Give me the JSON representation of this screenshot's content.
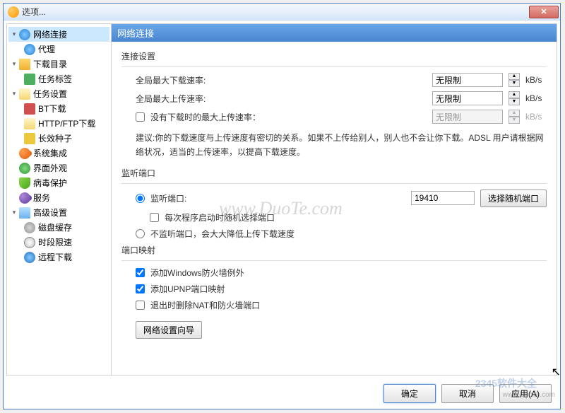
{
  "window": {
    "title": "选项..."
  },
  "sidebar": {
    "items": [
      {
        "label": "网络连接",
        "children": [
          {
            "label": "代理"
          }
        ]
      },
      {
        "label": "下载目录",
        "children": [
          {
            "label": "任务标签"
          }
        ]
      },
      {
        "label": "任务设置",
        "children": [
          {
            "label": "BT下载"
          },
          {
            "label": "HTTP/FTP下载"
          },
          {
            "label": "长效种子"
          }
        ]
      },
      {
        "label": "系统集成"
      },
      {
        "label": "界面外观"
      },
      {
        "label": "病毒保护"
      },
      {
        "label": "服务"
      },
      {
        "label": "高级设置",
        "children": [
          {
            "label": "磁盘缓存"
          },
          {
            "label": "时段限速"
          },
          {
            "label": "远程下载"
          }
        ]
      }
    ]
  },
  "content": {
    "header": "网络连接",
    "group_conn": "连接设置",
    "max_down_label": "全局最大下载速率:",
    "max_down_value": "无限制",
    "max_up_label": "全局最大上传速率:",
    "max_up_value": "无限制",
    "idle_upload_checkbox": "没有下载时的最大上传速率：",
    "idle_upload_value": "无限制",
    "unit": "kB/s",
    "advice": "建议:你的下载速度与上传速度有密切的关系。如果不上传给别人，别人也不会让你下载。ADSL 用户请根据网络状况，适当的上传速率，以提高下载速度。",
    "group_port": "监听端口",
    "listen_port_radio": "监听端口:",
    "listen_port_value": "19410",
    "random_port_btn": "选择随机端口",
    "random_on_start": "每次程序启动时随机选择端口",
    "no_listen_radio": "不监听端口，会大大降低上传下载速度",
    "group_map": "端口映射",
    "firewall_checkbox": "添加Windows防火墙例外",
    "upnp_checkbox": "添加UPNP端口映射",
    "del_nat_checkbox": "退出时删除NAT和防火墙端口",
    "wizard_btn": "网络设置向导"
  },
  "footer": {
    "ok": "确定",
    "cancel": "取消",
    "apply": "应用(A)"
  },
  "watermark": {
    "main": "www.DuoTe.com",
    "logo": "2345软件大全",
    "site": "www.DuoTe.com"
  }
}
